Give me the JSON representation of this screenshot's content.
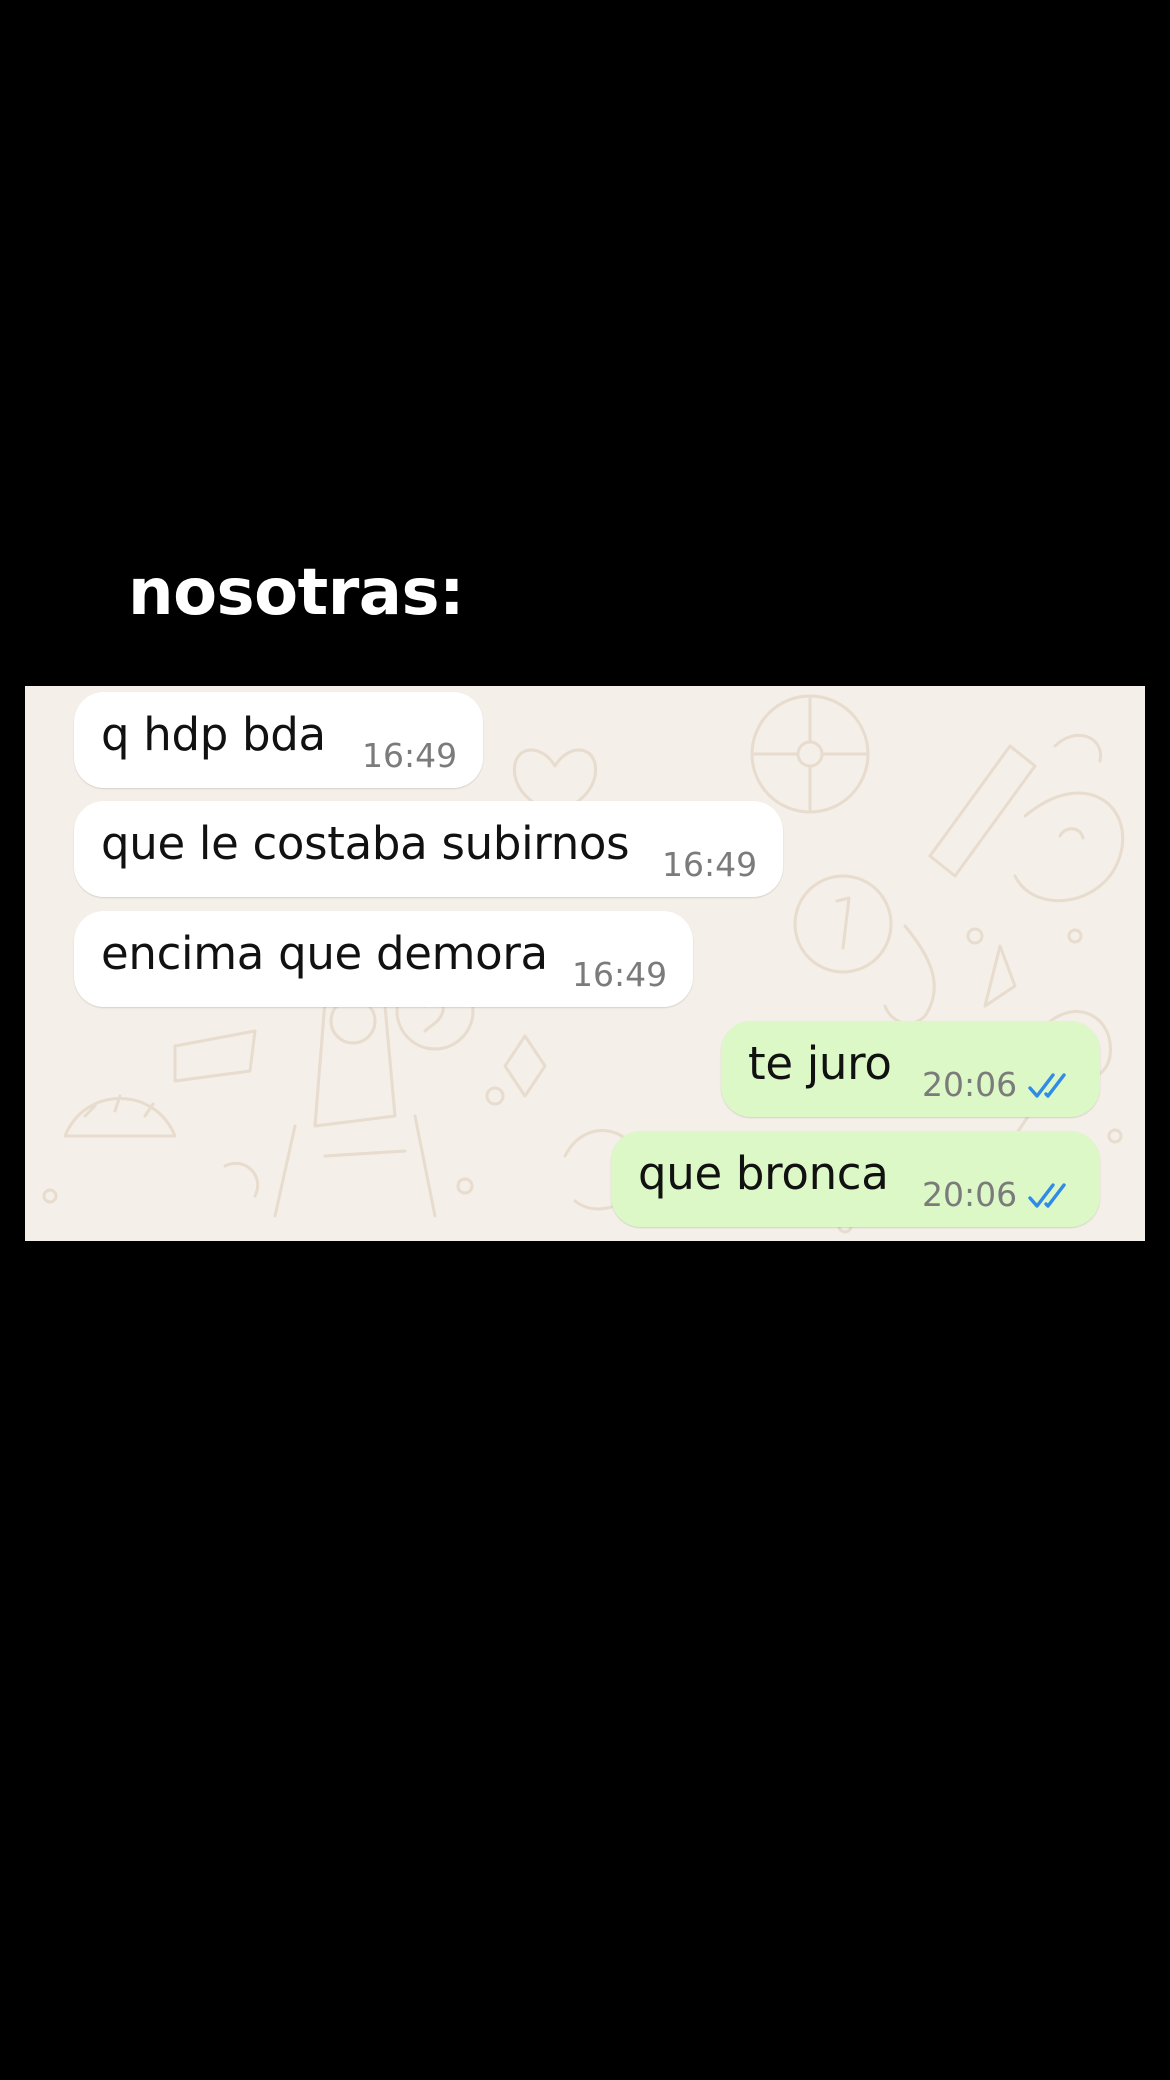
{
  "caption": "nosotras:",
  "messages": [
    {
      "direction": "in",
      "text": "q hdp bda",
      "time": "16:49"
    },
    {
      "direction": "in",
      "text": "que le costaba subirnos",
      "time": "16:49"
    },
    {
      "direction": "in",
      "text": "encima que demora",
      "time": "16:49"
    },
    {
      "direction": "out",
      "text": "te juro",
      "time": "20:06",
      "status": "read"
    },
    {
      "direction": "out",
      "text": "que bronca",
      "time": "20:06",
      "status": "read"
    }
  ],
  "colors": {
    "page_background": "#000000",
    "chat_wallpaper": "#f4efe8",
    "incoming_bubble": "#ffffff",
    "outgoing_bubble": "#dbf8c6",
    "read_ticks": "#2f8ae8",
    "timestamp": "#7b7b7b"
  },
  "icons": {
    "read_receipt": "double-check-icon"
  }
}
